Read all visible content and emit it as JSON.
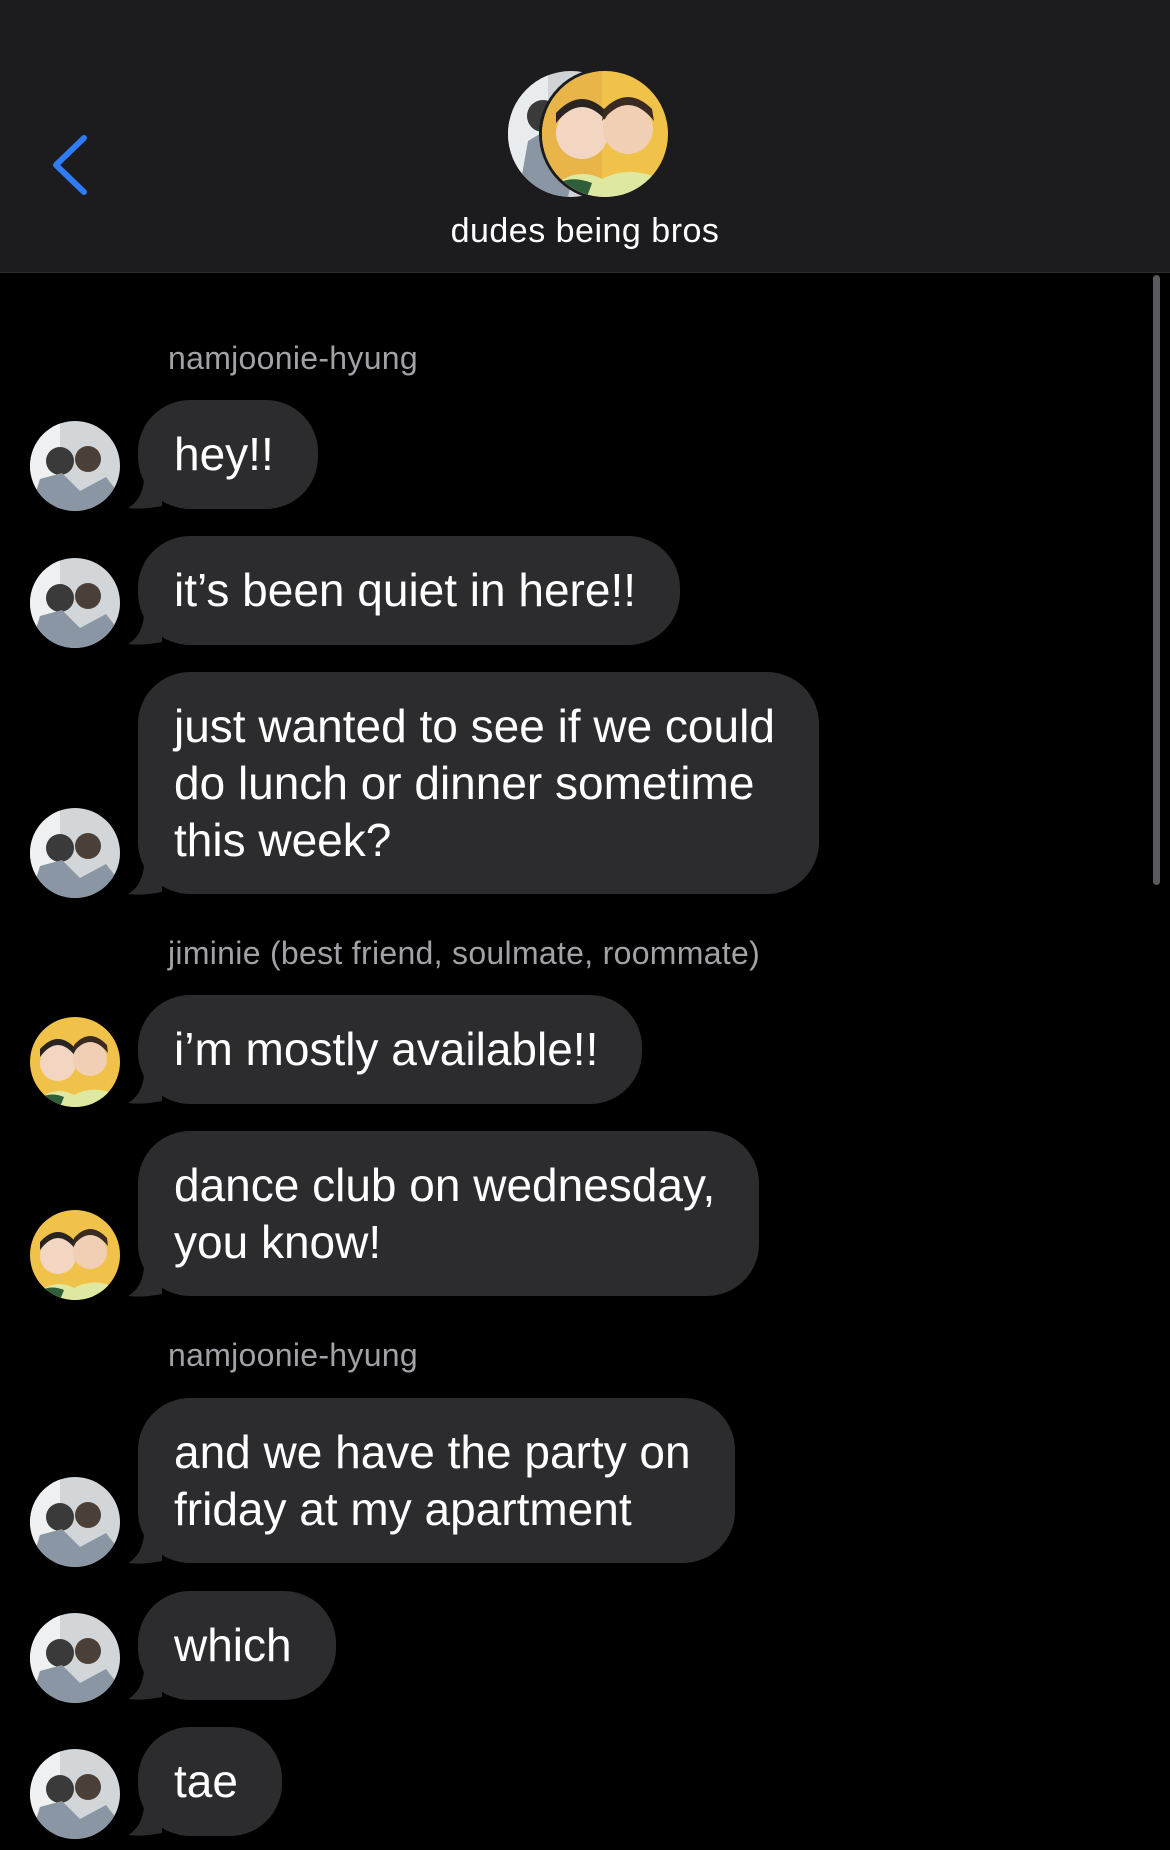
{
  "header": {
    "back_icon": "chevron-left-icon",
    "title": "dudes being bros",
    "accent_color": "#2f7cf6"
  },
  "colors": {
    "background": "#000000",
    "header_bg": "#1c1c1e",
    "bubble_bg": "#2c2c2e",
    "sender_text": "#a1a1a6"
  },
  "senders": [
    "namjoonie-hyung",
    "jiminie (best friend, soulmate, roommate)",
    "namjoonie-hyung"
  ],
  "messages": [
    {
      "text": "hey!!"
    },
    {
      "text": "it’s been quiet in here!!"
    },
    {
      "lines": [
        "just wanted to see if we could",
        "do lunch or dinner sometime",
        "this week?"
      ]
    },
    {
      "text": "i’m mostly available!!"
    },
    {
      "lines": [
        "dance club on wednesday,",
        "you know!"
      ]
    },
    {
      "lines": [
        "and we have the party on",
        "friday at my apartment"
      ]
    },
    {
      "text": "which"
    },
    {
      "text": "tae"
    }
  ]
}
